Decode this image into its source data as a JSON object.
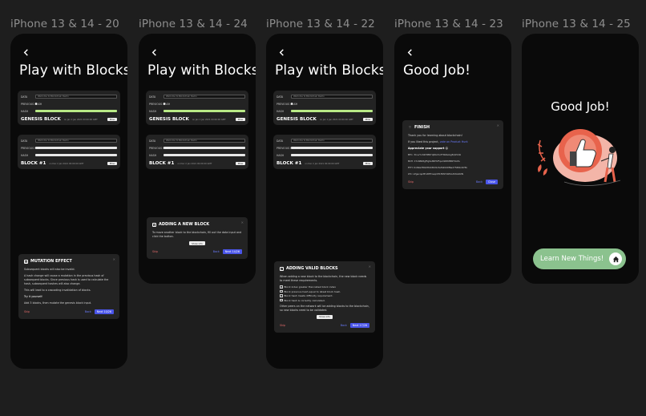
{
  "frames": [
    {
      "title": "iPhone 13 & 14 - 20",
      "screen_title": "Play with Blocks"
    },
    {
      "title": "iPhone 13 & 14 - 24",
      "screen_title": "Play with Blocks"
    },
    {
      "title": "iPhone 13 & 14 - 22",
      "screen_title": "Play with Blocks"
    },
    {
      "title": "iPhone 13 & 14 - 23",
      "screen_title": "Good Job!"
    },
    {
      "title": "iPhone 13 & 14 - 25",
      "screen_title": "Good Job!"
    }
  ],
  "blocks": {
    "data_label": "DATA",
    "data_value": "Welcome to Blockchain Demo",
    "prev_hash_label": "PREVIOUS HASH",
    "hash_label": "HASH",
    "genesis_name": "GENESIS BLOCK",
    "genesis_time": "on Jan 1 Jan 2021 00:00:00 GMT",
    "block1_name": "BLOCK #1",
    "block1_time": "on Dec 2 Jan 2021 00:00:00 GMT",
    "mine_label": "Mine"
  },
  "mutation_dialog": {
    "title": "MUTATION EFFECT",
    "p1": "Subsequent blocks will also be invalid.",
    "p2": "A hash change will cause a mutation in the previous hash of subsequent blocks. Since previous hash is used to calculate the hash, subsequent hashes will also change.",
    "p3": "This will lead to a cascading invalidation of blocks.",
    "p4": "Try it yourself:",
    "p5": "Add 3 blocks, then mutate the genesis block input.",
    "skip": "Skip",
    "back": "Back",
    "next": "Next 10/26"
  },
  "add_block_dialog": {
    "title": "ADDING A NEW BLOCK",
    "p1": "To move another block to the blockchain, fill out the data input and click the button.",
    "show_info": "Show info",
    "skip": "Skip",
    "back": "Back",
    "next": "Next 14/26"
  },
  "valid_blocks_dialog": {
    "title": "ADDING VALID BLOCKS",
    "p1": "When adding a new block to the blockchain, the new block needs to meet these requirements.",
    "checks": [
      "Block index greater than latest block index",
      "Block previous hash equal to latest block hash.",
      "Block hash meets difficulty requirement.",
      "Block hash is correctly calculated."
    ],
    "p2": "Other peers on the network will be adding blocks to the blockchain, so new blocks need to be validated.",
    "show_info": "Show info",
    "skip": "Skip",
    "back": "Back",
    "next": "Next 17/26"
  },
  "finish_dialog": {
    "title": "FINISH",
    "p1": "Thank you for learning about blockchain!",
    "p2_prefix": "If you liked this project,",
    "p2_link": "vote on Product Hunt",
    "p3": "Appreciate your support",
    "addresses": [
      "BTC: 3CuvYnhKHMDYqNCo5uTHKZwGg5Qk5dlz",
      "BCH: 1YLN8k8gFtg9u8RHVFqamPZ0P9NT4o5v",
      "ETH: 0x69a3f02dfb9d5d9c3ef420d0f6ad7565bd1f3b",
      "LTC: LPgecqe3EnNTP1aqmE1fNhHrWDo2ShGRUN"
    ],
    "skip": "Skip",
    "back": "Back",
    "close": "Close"
  },
  "good_job": {
    "title": "Good Job!",
    "cta_label": "Learn New Things!"
  },
  "colors": {
    "background": "#1e1e1e",
    "phone": "#0a0a0a",
    "card": "#232323",
    "hash_valid": "#b8e986",
    "accent": "#4a55e8",
    "skip": "#e46b6b",
    "cta": "#8bc28e"
  }
}
